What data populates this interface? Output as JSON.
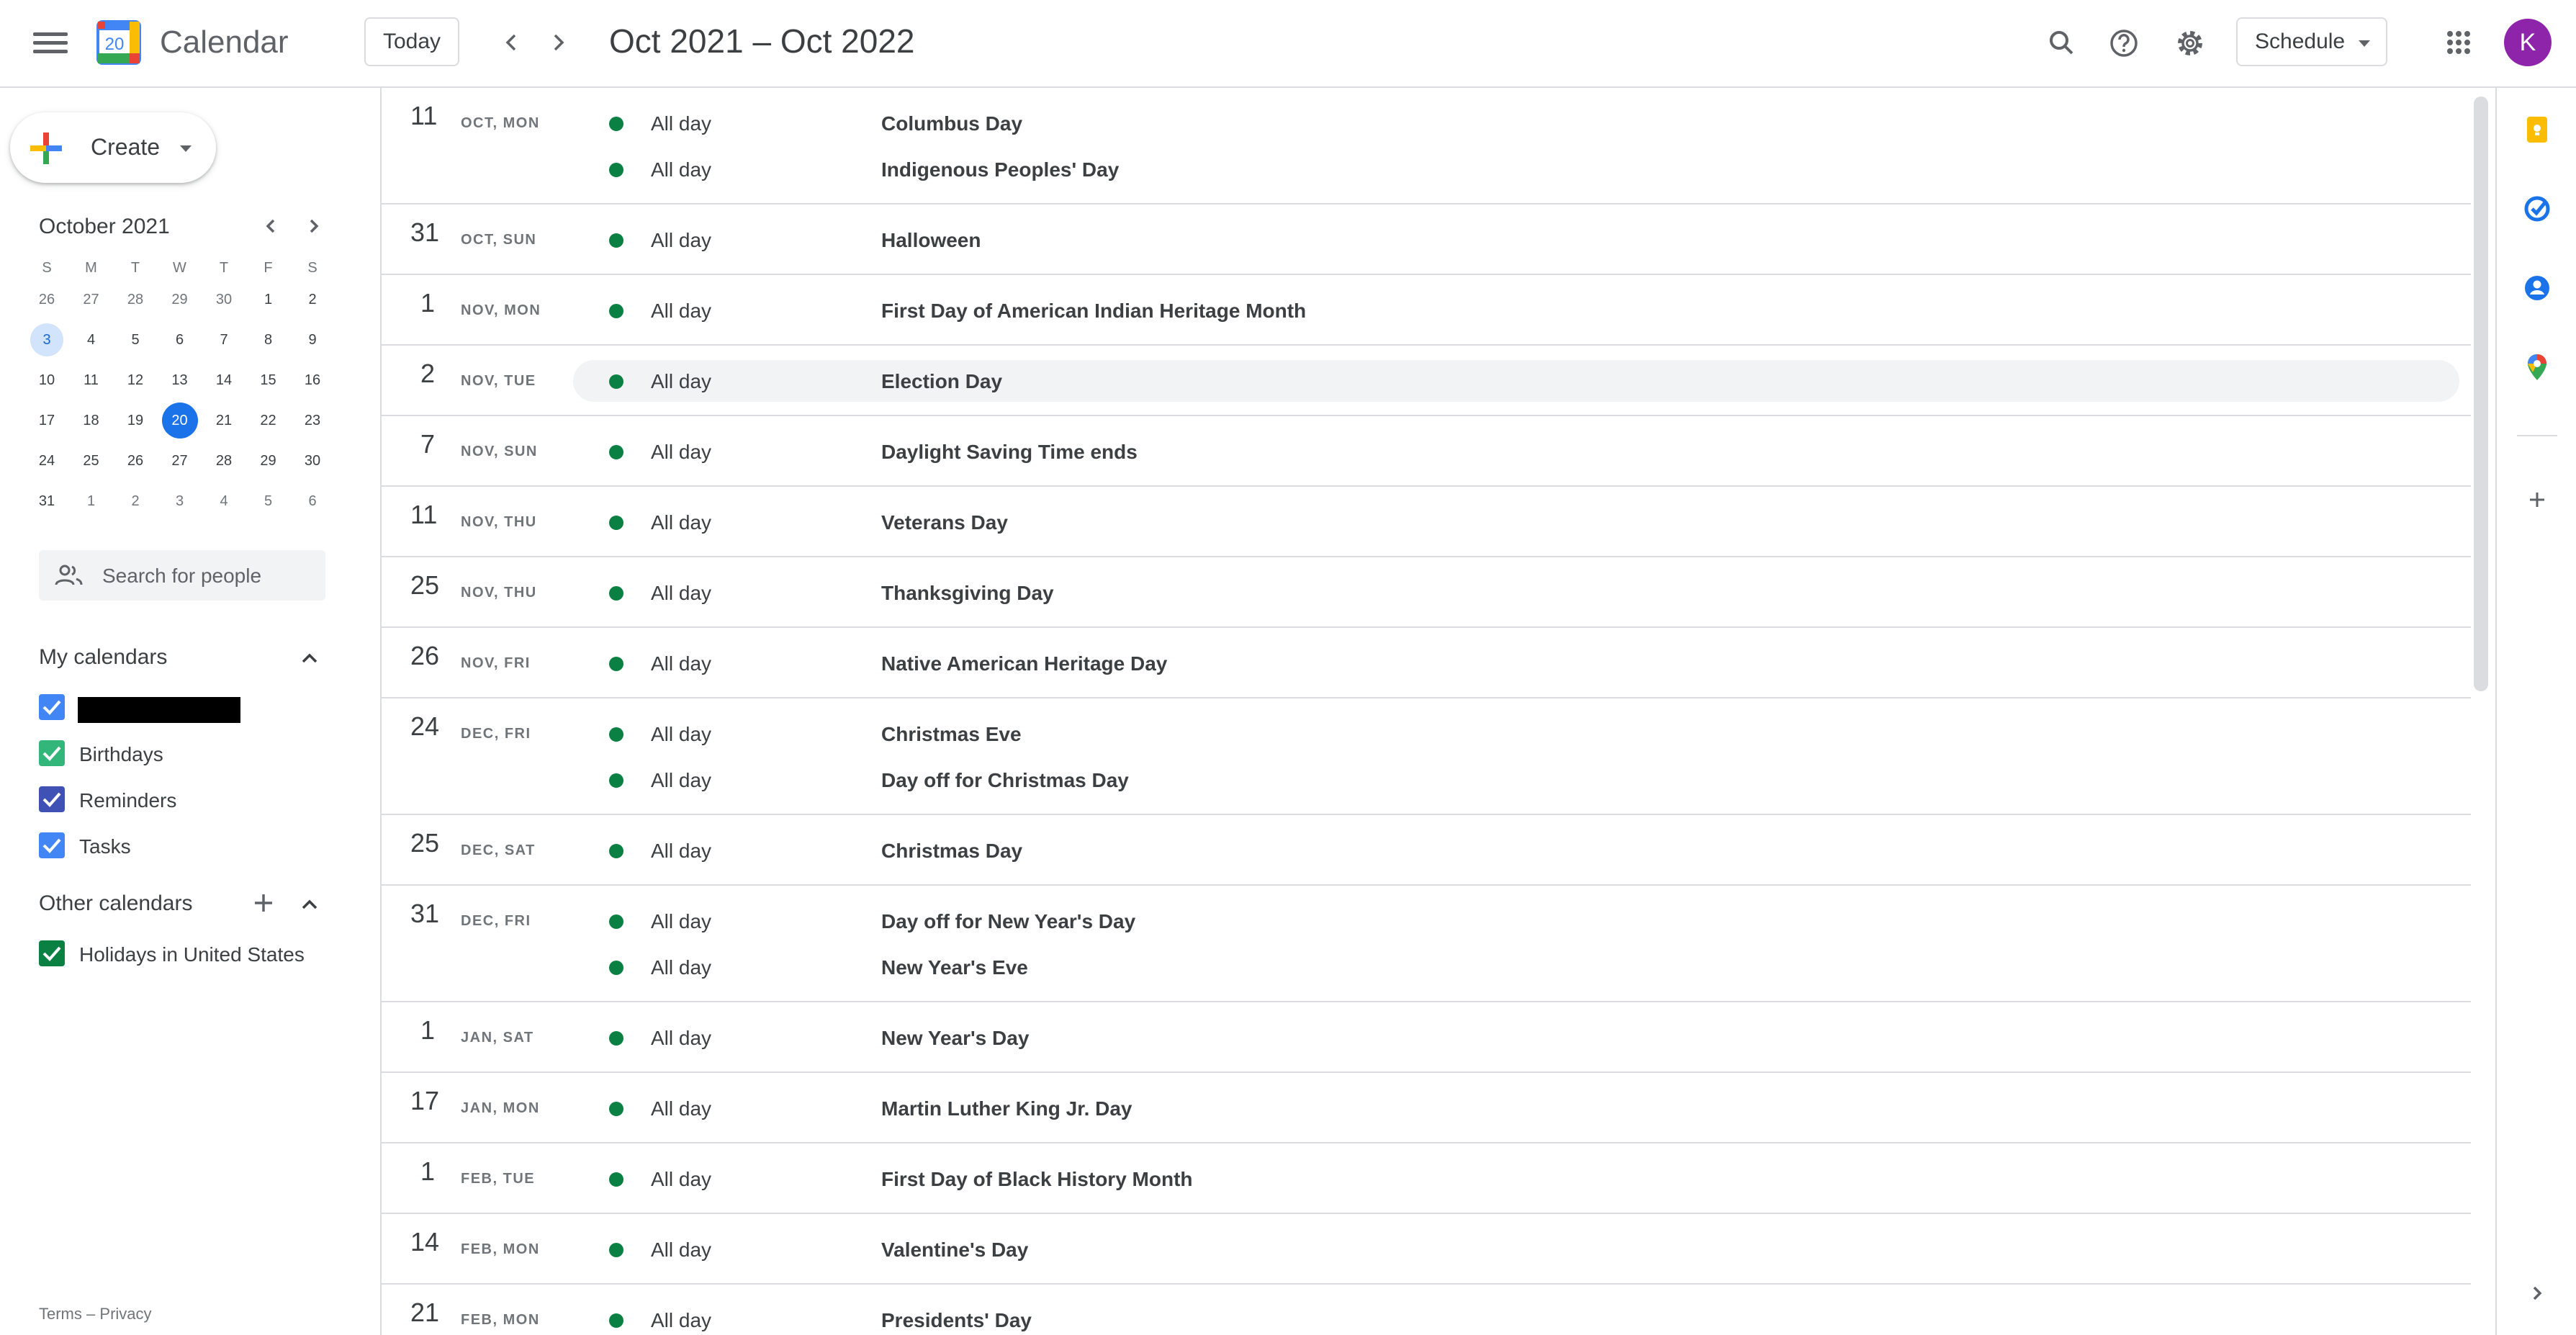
{
  "header": {
    "app_title": "Calendar",
    "logo_day": "20",
    "today_label": "Today",
    "range_title": "Oct 2021 – Oct 2022",
    "view_label": "Schedule",
    "avatar_initial": "K"
  },
  "sidebar": {
    "create_label": "Create",
    "mini_calendar": {
      "month_title": "October 2021",
      "weekdays": [
        "S",
        "M",
        "T",
        "W",
        "T",
        "F",
        "S"
      ],
      "weeks": [
        [
          "26",
          "27",
          "28",
          "29",
          "30",
          "1",
          "2"
        ],
        [
          "3",
          "4",
          "5",
          "6",
          "7",
          "8",
          "9"
        ],
        [
          "10",
          "11",
          "12",
          "13",
          "14",
          "15",
          "16"
        ],
        [
          "17",
          "18",
          "19",
          "20",
          "21",
          "22",
          "23"
        ],
        [
          "24",
          "25",
          "26",
          "27",
          "28",
          "29",
          "30"
        ],
        [
          "31",
          "1",
          "2",
          "3",
          "4",
          "5",
          "6"
        ]
      ],
      "selected_day": "3",
      "today_day": "20"
    },
    "people_search_placeholder": "Search for people",
    "my_calendars_title": "My calendars",
    "my_calendars": [
      {
        "name": "",
        "color": "#4285f4",
        "redacted": true
      },
      {
        "name": "Birthdays",
        "color": "#33b679"
      },
      {
        "name": "Reminders",
        "color": "#3f51b5"
      },
      {
        "name": "Tasks",
        "color": "#4285f4"
      }
    ],
    "other_calendars_title": "Other calendars",
    "other_calendars": [
      {
        "name": "Holidays in United States",
        "color": "#0b8043"
      }
    ],
    "footer_terms": "Terms",
    "footer_sep": "–",
    "footer_privacy": "Privacy"
  },
  "schedule": {
    "all_day_label": "All day",
    "event_color": "#0b8043",
    "days": [
      {
        "num": "11",
        "label": "OCT, MON",
        "events": [
          "Columbus Day",
          "Indigenous Peoples' Day"
        ]
      },
      {
        "num": "31",
        "label": "OCT, SUN",
        "events": [
          "Halloween"
        ]
      },
      {
        "num": "1",
        "label": "NOV, MON",
        "events": [
          "First Day of American Indian Heritage Month"
        ]
      },
      {
        "num": "2",
        "label": "NOV, TUE",
        "events": [
          "Election Day"
        ],
        "highlighted": true
      },
      {
        "num": "7",
        "label": "NOV, SUN",
        "events": [
          "Daylight Saving Time ends"
        ]
      },
      {
        "num": "11",
        "label": "NOV, THU",
        "events": [
          "Veterans Day"
        ]
      },
      {
        "num": "25",
        "label": "NOV, THU",
        "events": [
          "Thanksgiving Day"
        ]
      },
      {
        "num": "26",
        "label": "NOV, FRI",
        "events": [
          "Native American Heritage Day"
        ]
      },
      {
        "num": "24",
        "label": "DEC, FRI",
        "events": [
          "Christmas Eve",
          "Day off for Christmas Day"
        ]
      },
      {
        "num": "25",
        "label": "DEC, SAT",
        "events": [
          "Christmas Day"
        ]
      },
      {
        "num": "31",
        "label": "DEC, FRI",
        "events": [
          "Day off for New Year's Day",
          "New Year's Eve"
        ]
      },
      {
        "num": "1",
        "label": "JAN, SAT",
        "events": [
          "New Year's Day"
        ]
      },
      {
        "num": "17",
        "label": "JAN, MON",
        "events": [
          "Martin Luther King Jr. Day"
        ]
      },
      {
        "num": "1",
        "label": "FEB, TUE",
        "events": [
          "First Day of Black History Month"
        ]
      },
      {
        "num": "14",
        "label": "FEB, MON",
        "events": [
          "Valentine's Day"
        ]
      },
      {
        "num": "21",
        "label": "FEB, MON",
        "events": [
          "Presidents' Day"
        ]
      }
    ]
  }
}
